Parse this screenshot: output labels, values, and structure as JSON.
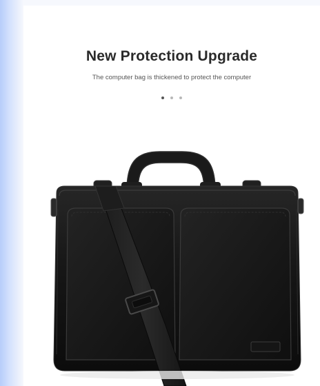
{
  "banner": {
    "title": "New Protection Upgrade",
    "subtitle": "The computer bag is thickened to protect the computer"
  },
  "carousel": {
    "slide_count": 3,
    "active_index": 0
  },
  "product": {
    "image_subject": "black-laptop-briefcase-with-shoulder-strap",
    "color": "#141414"
  }
}
